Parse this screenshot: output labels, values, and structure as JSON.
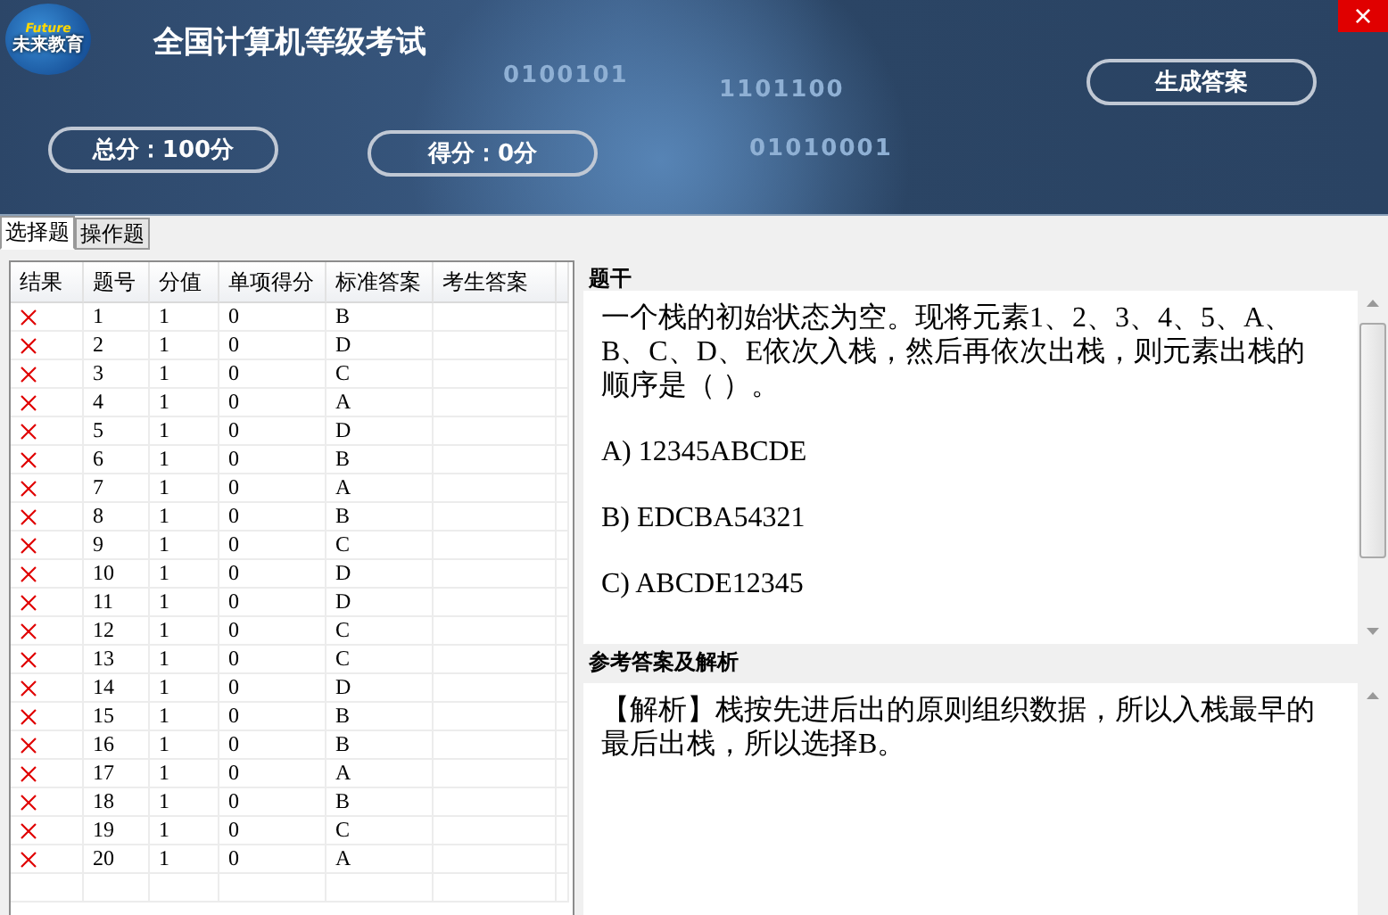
{
  "logo": {
    "latin": "Future",
    "name": "未来教育"
  },
  "window": {
    "title": "全国计算机等级考试",
    "close": "×"
  },
  "background_digits": [
    "0100101",
    "1101100",
    "01010001"
  ],
  "score_total": "总分：100分",
  "score_got": "得分：0分",
  "generate_button": "生成答案",
  "tabs": [
    {
      "label": "选择题",
      "selected": true
    },
    {
      "label": "操作题",
      "selected": false
    }
  ],
  "table": {
    "columns": [
      "结果",
      "题号",
      "分值",
      "单项得分",
      "标准答案",
      "考生答案"
    ],
    "rows": [
      {
        "correct": false,
        "no": "1",
        "value": "1",
        "score": "0",
        "answer": "B"
      },
      {
        "correct": false,
        "no": "2",
        "value": "1",
        "score": "0",
        "answer": "D"
      },
      {
        "correct": false,
        "no": "3",
        "value": "1",
        "score": "0",
        "answer": "C"
      },
      {
        "correct": false,
        "no": "4",
        "value": "1",
        "score": "0",
        "answer": "A"
      },
      {
        "correct": false,
        "no": "5",
        "value": "1",
        "score": "0",
        "answer": "D"
      },
      {
        "correct": false,
        "no": "6",
        "value": "1",
        "score": "0",
        "answer": "B"
      },
      {
        "correct": false,
        "no": "7",
        "value": "1",
        "score": "0",
        "answer": "A"
      },
      {
        "correct": false,
        "no": "8",
        "value": "1",
        "score": "0",
        "answer": "B"
      },
      {
        "correct": false,
        "no": "9",
        "value": "1",
        "score": "0",
        "answer": "C"
      },
      {
        "correct": false,
        "no": "10",
        "value": "1",
        "score": "0",
        "answer": "D"
      },
      {
        "correct": false,
        "no": "11",
        "value": "1",
        "score": "0",
        "answer": "D"
      },
      {
        "correct": false,
        "no": "12",
        "value": "1",
        "score": "0",
        "answer": "C"
      },
      {
        "correct": false,
        "no": "13",
        "value": "1",
        "score": "0",
        "answer": "C"
      },
      {
        "correct": false,
        "no": "14",
        "value": "1",
        "score": "0",
        "answer": "D"
      },
      {
        "correct": false,
        "no": "15",
        "value": "1",
        "score": "0",
        "answer": "B"
      },
      {
        "correct": false,
        "no": "16",
        "value": "1",
        "score": "0",
        "answer": "B"
      },
      {
        "correct": false,
        "no": "17",
        "value": "1",
        "score": "0",
        "answer": "A"
      },
      {
        "correct": false,
        "no": "18",
        "value": "1",
        "score": "0",
        "answer": "B"
      },
      {
        "correct": false,
        "no": "19",
        "value": "1",
        "score": "0",
        "answer": "C"
      },
      {
        "correct": false,
        "no": "20",
        "value": "1",
        "score": "0",
        "answer": "A"
      }
    ]
  },
  "question": {
    "heading": "题干",
    "paragraphs": [
      "一个栈的初始状态为空。现将元素1、2、3、4、5、A、B、C、D、E依次入栈，然后再依次出栈，则元素出栈的顺序是（ ）。",
      "A) 12345ABCDE",
      "B) EDCBA54321",
      "C) ABCDE12345"
    ]
  },
  "analysis": {
    "heading": "参考答案及解析",
    "paragraphs": [
      "【解析】栈按先进后出的原则组织数据，所以入栈最早的最后出栈，所以选择B。"
    ]
  }
}
